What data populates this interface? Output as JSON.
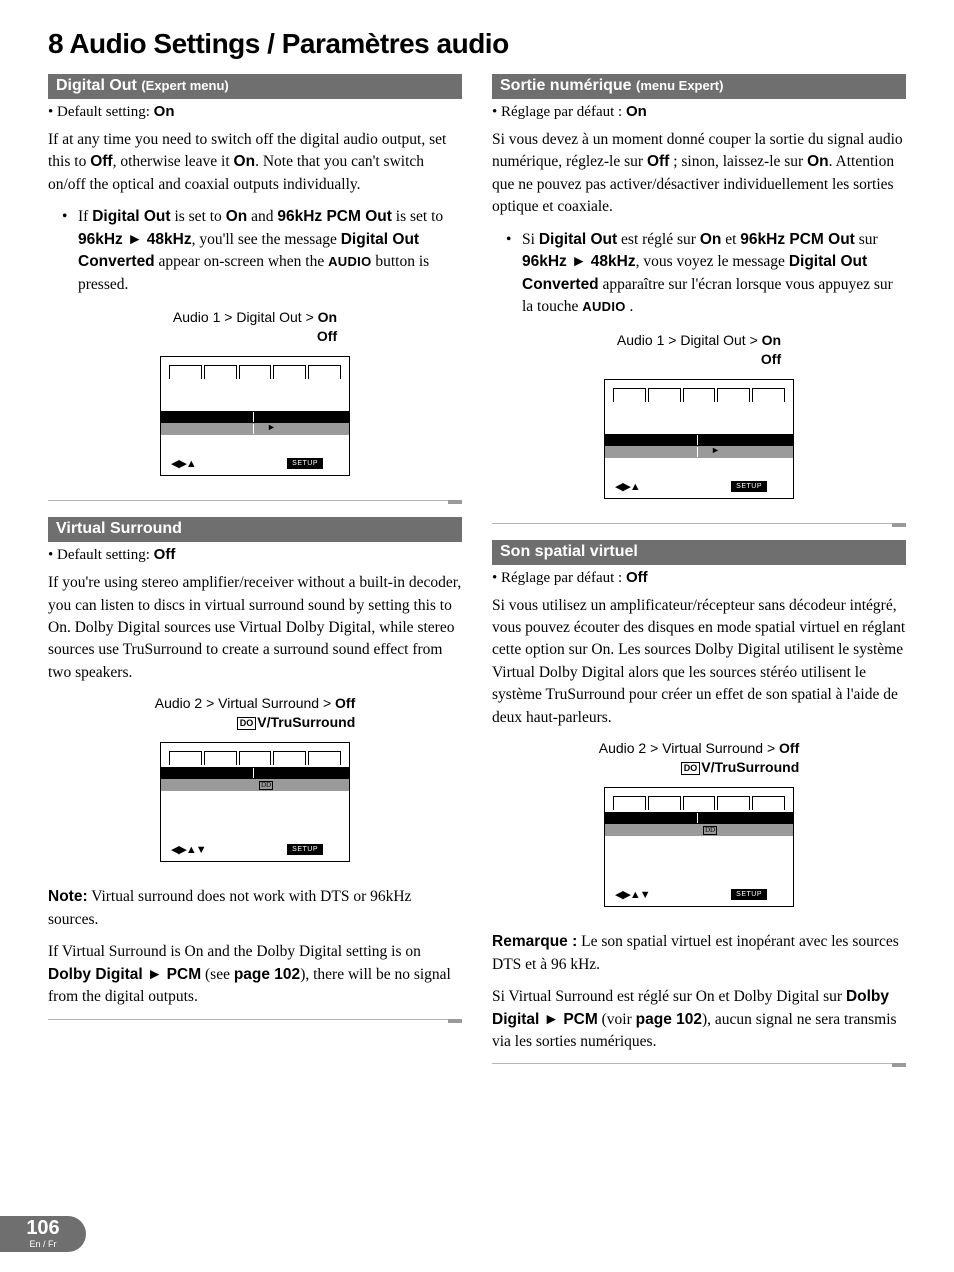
{
  "page_title": "8 Audio Settings / Paramètres audio",
  "left": {
    "digital_out": {
      "header_main": "Digital Out ",
      "header_sub": "(Expert menu)",
      "default_prefix": "• Default setting: ",
      "default_value": "On",
      "para1_a": "If at any time you need to switch off the digital audio output, set this to ",
      "para1_off": "Off",
      "para1_b": ", otherwise leave it ",
      "para1_on": "On",
      "para1_c": ". Note that you can't switch on/off the optical and coaxial outputs individually.",
      "bullet_a": "If ",
      "bullet_digital_out": "Digital Out",
      "bullet_b": " is set to ",
      "bullet_on": "On",
      "bullet_c": " and ",
      "bullet_96k_out": "96kHz PCM Out",
      "bullet_d": " is set to ",
      "bullet_96_48": "96kHz ► 48kHz",
      "bullet_e": ", you'll see the message ",
      "bullet_msg": "Digital Out Converted",
      "bullet_f": " appear on-screen when the ",
      "bullet_audio": "AUDIO",
      "bullet_g": " button is pressed.",
      "menu_line1_a": "Audio 1 > Digital Out > ",
      "menu_line1_on": "On",
      "menu_line2": "Off",
      "setup_label": "SETUP"
    },
    "virtual_surround": {
      "header": "Virtual Surround",
      "default_prefix": "• Default setting: ",
      "default_value": "Off",
      "para1": "If you're using stereo amplifier/receiver without a built-in decoder, you can listen to discs in virtual surround sound by setting this to On. Dolby Digital sources use Virtual Dolby Digital, while stereo sources use TruSurround to create a surround sound effect from two speakers.",
      "menu_line1_a": "Audio 2 > Virtual Surround > ",
      "menu_line1_off": "Off",
      "menu_line2_v": "V/TruSurround",
      "setup_label": "SETUP",
      "note_label": "Note:",
      "note_text": " Virtual surround does not work with DTS or 96kHz sources.",
      "para2_a": "If Virtual Surround is On and the Dolby Digital setting is on ",
      "para2_dd": "Dolby Digital ► PCM",
      "para2_b": " (see ",
      "para2_page": "page 102",
      "para2_c": "), there will be no signal from the digital outputs."
    }
  },
  "right": {
    "sortie_num": {
      "header_main": "Sortie numérique ",
      "header_sub": "(menu Expert)",
      "default_prefix": "• Réglage par défaut : ",
      "default_value": "On",
      "para1_a": "Si vous devez à un moment donné couper la sortie du signal audio numérique, réglez-le sur ",
      "para1_off": "Off",
      "para1_b": " ; sinon, laissez-le sur ",
      "para1_on": "On",
      "para1_c": ". Attention que ne pouvez pas activer/désactiver individuellement les sorties optique et coaxiale.",
      "bullet_a": "Si ",
      "bullet_digital_out": "Digital Out",
      "bullet_b": " est réglé sur ",
      "bullet_on": "On",
      "bullet_c": " et ",
      "bullet_96k_out": "96kHz PCM Out",
      "bullet_d": " sur ",
      "bullet_96_48": "96kHz ► 48kHz",
      "bullet_e": ", vous voyez le message ",
      "bullet_msg": "Digital Out Converted",
      "bullet_f": " apparaître sur l'écran lorsque vous appuyez sur la touche ",
      "bullet_audio": "AUDIO",
      "bullet_g": " .",
      "menu_line1_a": "Audio 1 > Digital Out > ",
      "menu_line1_on": "On",
      "menu_line2": "Off",
      "setup_label": "SETUP"
    },
    "son_spatial": {
      "header": "Son spatial virtuel",
      "default_prefix": "• Réglage par défaut : ",
      "default_value": "Off",
      "para1": "Si vous utilisez un amplificateur/récepteur sans décodeur intégré, vous pouvez écouter des disques en mode spatial virtuel en réglant cette option sur On. Les sources Dolby Digital utilisent le système Virtual Dolby Digital alors que les sources stéréo utilisent le système TruSurround pour créer un effet de son spatial à l'aide de deux haut-parleurs.",
      "menu_line1_a": "Audio 2 > Virtual Surround > ",
      "menu_line1_off": "Off",
      "menu_line2_v": "V/TruSurround",
      "setup_label": "SETUP",
      "note_label": "Remarque :",
      "note_text": " Le son spatial virtuel est inopérant avec les sources DTS et à 96 kHz.",
      "para2_a": "Si Virtual Surround est réglé sur On et Dolby Digital sur ",
      "para2_dd": "Dolby Digital ► PCM",
      "para2_b": " (voir ",
      "para2_page": "page 102",
      "para2_c": "), aucun signal ne sera transmis via les sorties numériques."
    }
  },
  "page_number": "106",
  "page_lang": "En / Fr"
}
